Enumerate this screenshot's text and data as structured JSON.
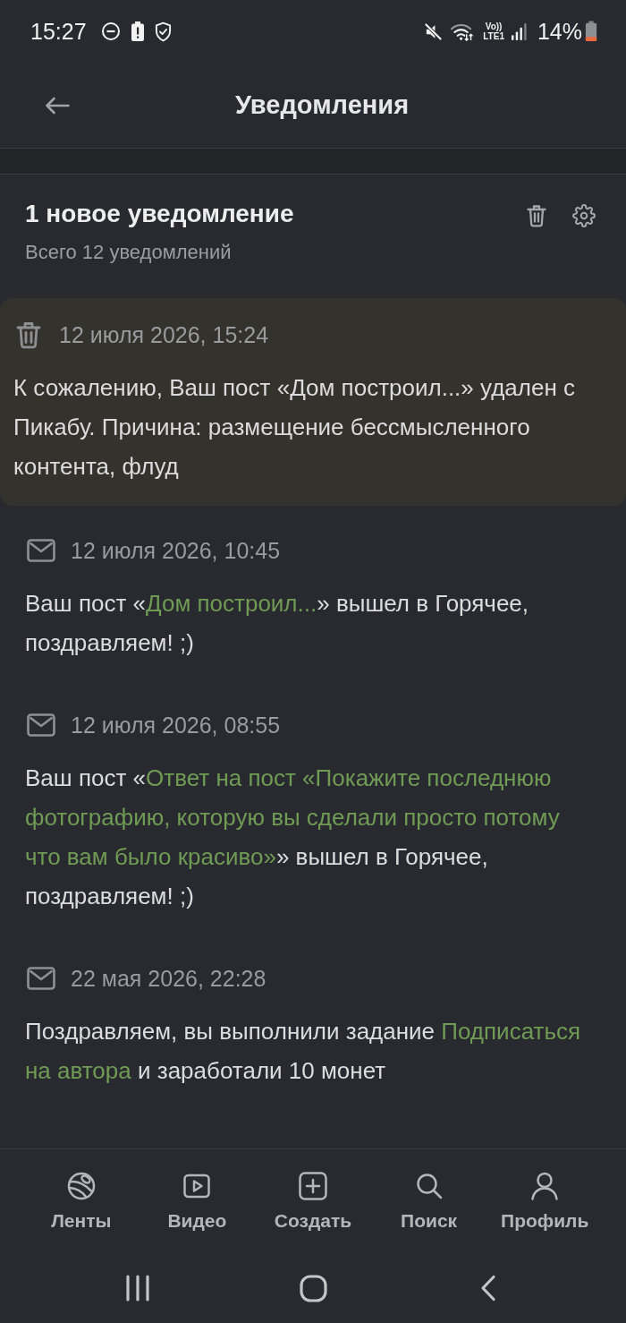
{
  "status_bar": {
    "time": "15:27",
    "network_top": "Vo))",
    "network_bottom": "LTE1",
    "battery": "14%"
  },
  "header": {
    "title": "Уведомления"
  },
  "summary": {
    "title": "1 новое уведомление",
    "subtitle": "Всего 12 уведомлений"
  },
  "notifications": [
    {
      "kind": "deleted",
      "unread": true,
      "date": "12 июля 2026, 15:24",
      "parts": [
        {
          "text": "К сожалению, Ваш пост «Дом построил...» удален с Пикабу. Причина: размещение бессмысленного контента, флуд",
          "link": false
        }
      ]
    },
    {
      "kind": "mail",
      "unread": false,
      "date": "12 июля 2026, 10:45",
      "parts": [
        {
          "text": "Ваш пост «",
          "link": false
        },
        {
          "text": "Дом построил...",
          "link": true
        },
        {
          "text": "» вышел в Горячее, поздравляем! ;)",
          "link": false
        }
      ]
    },
    {
      "kind": "mail",
      "unread": false,
      "date": "12 июля 2026, 08:55",
      "parts": [
        {
          "text": "Ваш пост «",
          "link": false
        },
        {
          "text": "Ответ на пост «Покажите последнюю",
          "link": true
        },
        {
          "text": "фотографию, которую вы сделали просто потому",
          "link": true
        },
        {
          "text": "что вам было красиво»",
          "link": true
        },
        {
          "text": "» вышел в Горячее, поздравляем! ;)",
          "link": false
        }
      ]
    },
    {
      "kind": "mail",
      "unread": false,
      "date": "22 мая 2026, 22:28",
      "parts": [
        {
          "text": "Поздравляем, вы выполнили задание ",
          "link": false
        },
        {
          "text": "Подписаться",
          "link": true
        },
        {
          "text": "на автора",
          "link": true
        },
        {
          "text": " и заработали 10 монет",
          "link": false
        }
      ]
    }
  ],
  "bottom_nav": [
    {
      "kind": "feeds",
      "label": "Ленты"
    },
    {
      "kind": "video",
      "label": "Видео"
    },
    {
      "kind": "create",
      "label": "Создать"
    },
    {
      "kind": "search",
      "label": "Поиск"
    },
    {
      "kind": "profile",
      "label": "Профиль"
    }
  ]
}
